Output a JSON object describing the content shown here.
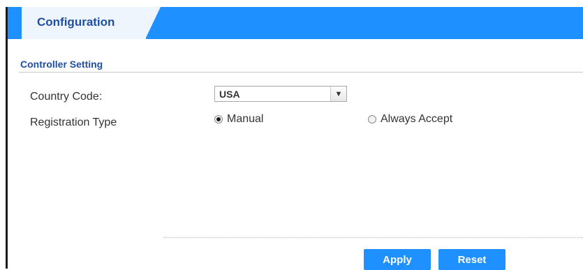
{
  "tabs": [
    {
      "label": "Configuration"
    }
  ],
  "section": {
    "title": "Controller Setting"
  },
  "fields": {
    "country_code": {
      "label": "Country Code:",
      "value": "USA"
    },
    "registration_type": {
      "label": "Registration Type",
      "options": [
        {
          "label": "Manual",
          "checked": true
        },
        {
          "label": "Always Accept",
          "checked": false
        }
      ]
    }
  },
  "buttons": {
    "apply": "Apply",
    "reset": "Reset"
  },
  "colors": {
    "accent": "#1e90ff",
    "title_text": "#1f4fa3",
    "tab_bg": "#eef5fd"
  },
  "icons": {
    "select_arrow": "chevron-down-icon"
  }
}
